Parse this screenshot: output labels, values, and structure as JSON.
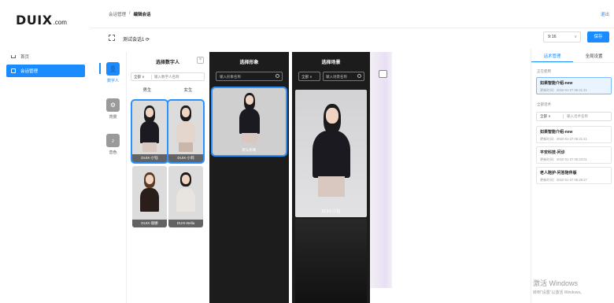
{
  "logo": {
    "main": "DUIX",
    "suffix": ".com"
  },
  "sidebar": {
    "items": [
      {
        "label": "首页"
      },
      {
        "label": "会话管理"
      }
    ]
  },
  "header": {
    "breadcrumb": [
      "会话管理",
      "/",
      "编辑会话"
    ],
    "logout": "退出"
  },
  "titlebar": {
    "session_title": "测试会话1 ⟳",
    "ratio": "9:16",
    "save": "保存"
  },
  "tool_rail": {
    "items": [
      {
        "label": "数字人"
      },
      {
        "label": "背景"
      },
      {
        "label": "音色"
      }
    ]
  },
  "digital_person_panel": {
    "title": "选择数字人",
    "filter_select": "全部 ∨",
    "filter_placeholder": "输入数字人名称",
    "genders": [
      "男生",
      "女生"
    ],
    "thumbs": [
      {
        "caption": "DUIX-小钰"
      },
      {
        "caption": "DUIX-小莉"
      },
      {
        "caption": "DUIX-丽娜"
      },
      {
        "caption": "DUIX-Bella"
      }
    ]
  },
  "image_panel": {
    "title": "选择形象",
    "search_placeholder": "输入形象名称",
    "thumb_caption": "默认形象"
  },
  "preview_panel": {
    "title": "选择场景",
    "select": "全部 ∨",
    "search_placeholder": "输入场景名称",
    "caption": "DUIX-小钰"
  },
  "right_panel": {
    "tabs": [
      {
        "label": "话术管理"
      },
      {
        "label": "全局设置"
      }
    ],
    "in_use_label": "正在使用",
    "in_use_card": {
      "title": "如果智能介绍-new",
      "sub": "更新时间：2022-01-27 05:21:21"
    },
    "all_label": "全部话术",
    "filter_select": "全部 ∨",
    "filter_placeholder": "输入话术名称",
    "cards": [
      {
        "title": "如果智能介绍-new",
        "sub": "更新时间：2022-01-27 05:21:21"
      },
      {
        "title": "平安科技-问诊",
        "sub": "更新时间：2022-01-27 05:23:01"
      },
      {
        "title": "老人陪护-问答陪伴版",
        "sub": "更新时间：2022-01-27 05:29:37"
      }
    ]
  },
  "watermark": {
    "line1": "激活 Windows",
    "line2": "转到“设置”以激活 Windows。"
  },
  "colors": {
    "accent": "#1a8cff",
    "dark_panel": "#1c1c1c"
  }
}
